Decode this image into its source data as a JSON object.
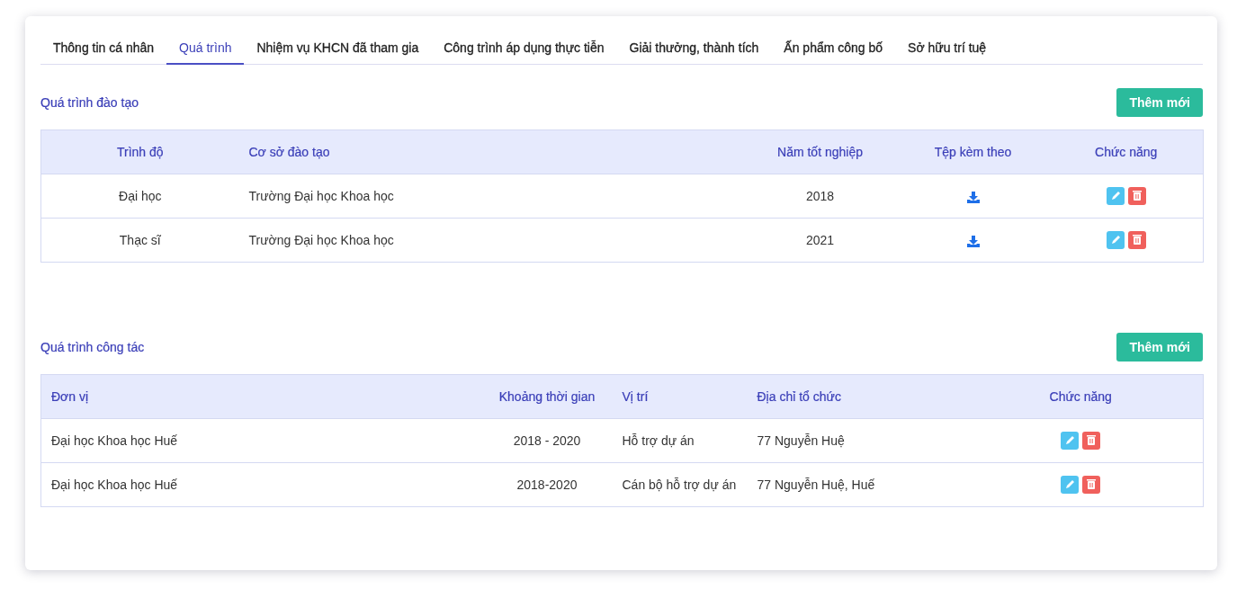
{
  "tabs": [
    {
      "label": "Thông tin cá nhân",
      "selected": false
    },
    {
      "label": "Quá trình",
      "selected": true
    },
    {
      "label": "Nhiệm vụ KHCN đã tham gia",
      "selected": false
    },
    {
      "label": "Công trình áp dụng thực tiễn",
      "selected": false
    },
    {
      "label": "Giải thưởng, thành tích",
      "selected": false
    },
    {
      "label": "Ấn phẩm công bố",
      "selected": false
    },
    {
      "label": "Sở hữu trí tuệ",
      "selected": false
    }
  ],
  "sections": [
    {
      "title": "Quá trình đào tạo",
      "button": "Thêm mới",
      "table": {
        "columns": [
          "Trình độ",
          "Cơ sở đào tạo",
          "Năm tốt nghiệp",
          "Tệp kèm theo",
          "Chức năng"
        ],
        "rows": [
          {
            "cells": [
              {
                "kind": "text",
                "text": "Đại học"
              },
              {
                "kind": "text",
                "text": "Trường Đại học Khoa học"
              },
              {
                "kind": "text",
                "text": "2018"
              },
              {
                "kind": "file"
              },
              {
                "kind": "actions"
              }
            ]
          },
          {
            "cells": [
              {
                "kind": "text",
                "text": "Thạc sĩ"
              },
              {
                "kind": "text",
                "text": "Trường Đại học Khoa học"
              },
              {
                "kind": "text",
                "text": "2021"
              },
              {
                "kind": "file"
              },
              {
                "kind": "actions"
              }
            ]
          }
        ]
      }
    },
    {
      "title": "Quá trình công tác",
      "button": "Thêm mới",
      "table": {
        "columns": [
          "Đơn vị",
          "Khoảng thời gian",
          "Vị trí",
          "Địa chỉ tổ chức",
          "Chức năng"
        ],
        "rows": [
          {
            "cells": [
              {
                "kind": "text",
                "text": "Đại học Khoa học Huế"
              },
              {
                "kind": "text",
                "text": "2018 - 2020"
              },
              {
                "kind": "text",
                "text": "Hỗ trợ dự án"
              },
              {
                "kind": "text",
                "text": "77 Nguyễn Huệ"
              },
              {
                "kind": "actions"
              }
            ]
          },
          {
            "cells": [
              {
                "kind": "text",
                "text": "Đại học Khoa học Huế"
              },
              {
                "kind": "text",
                "text": "2018-2020"
              },
              {
                "kind": "text",
                "text": "Cán bộ hỗ trợ dự án"
              },
              {
                "kind": "text",
                "text": "77 Nguyễn Huệ, Huế"
              },
              {
                "kind": "actions"
              }
            ]
          }
        ]
      }
    }
  ]
}
